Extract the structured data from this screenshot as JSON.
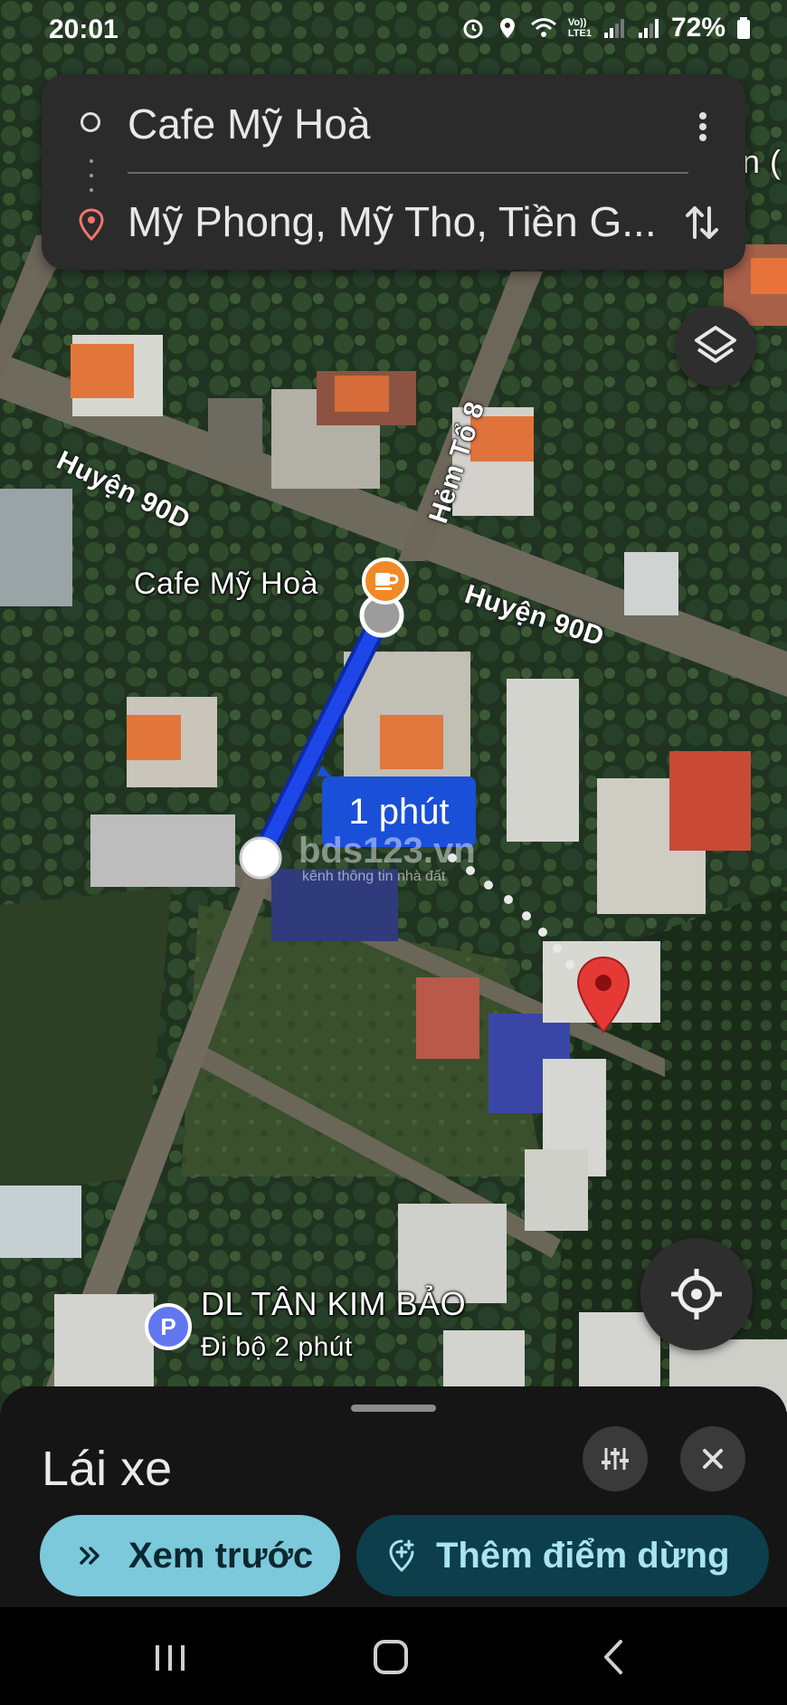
{
  "status_bar": {
    "time": "20:01",
    "network_label_top": "Vo))",
    "network_label_bottom": "LTE1",
    "battery": "72%"
  },
  "route": {
    "origin": "Cafe Mỹ Hoà",
    "destination": "Mỹ Phong, Mỹ Tho, Tiền G..."
  },
  "map": {
    "road_labels": [
      "Huyện 90D",
      "Huyện 90D",
      "Hẻm Tổ 8"
    ],
    "poi_cafe": "Cafe Mỹ Hoà",
    "duration_label": "1 phút",
    "parking_icon_letter": "P",
    "parking_name": "DL TÂN KIM BẢO",
    "parking_walk": "Đi bộ 2 phút",
    "edge_label": "n (",
    "watermark_main": "bds123.vn",
    "watermark_sub": "kênh thông tin nhà đất",
    "colors": {
      "route": "#1f46e8",
      "pin": "#e53935",
      "cafe": "#f08a24"
    }
  },
  "sheet": {
    "mode_title": "Lái xe",
    "preview_label": "Xem trước",
    "add_stop_label": "Thêm điểm dừng"
  },
  "icons": [
    "alarm-icon",
    "location-icon",
    "wifi-icon",
    "signal-icon",
    "battery-icon",
    "more-vert-icon",
    "swap-icon",
    "layers-icon",
    "my-location-icon",
    "tune-icon",
    "close-icon",
    "double-chevron-icon",
    "add-location-icon",
    "recents-icon",
    "home-icon",
    "back-icon"
  ]
}
